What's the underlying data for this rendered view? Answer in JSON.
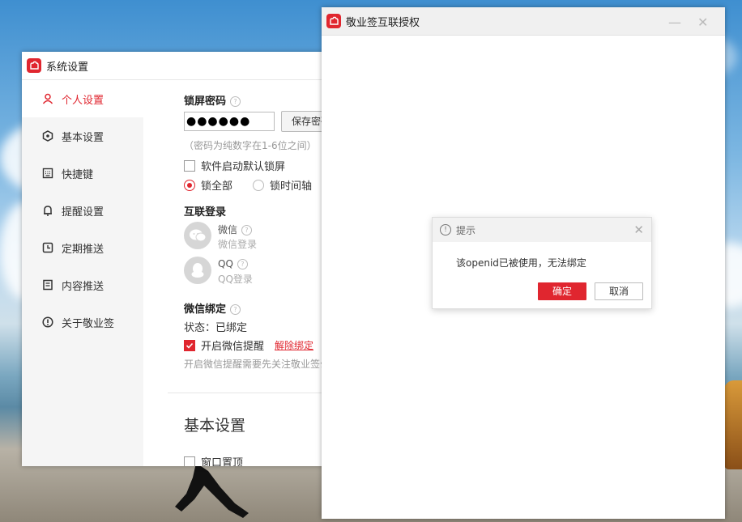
{
  "settings_window": {
    "title": "系统设置",
    "sidebar": {
      "items": [
        {
          "label": "个人设置",
          "icon": "user-icon",
          "active": true
        },
        {
          "label": "基本设置",
          "icon": "settings-icon",
          "active": false
        },
        {
          "label": "快捷键",
          "icon": "keyboard-icon",
          "active": false
        },
        {
          "label": "提醒设置",
          "icon": "bell-icon",
          "active": false
        },
        {
          "label": "定期推送",
          "icon": "clock-icon",
          "active": false
        },
        {
          "label": "内容推送",
          "icon": "document-icon",
          "active": false
        },
        {
          "label": "关于敬业签",
          "icon": "info-icon",
          "active": false
        }
      ]
    },
    "lock_password": {
      "title": "锁屏密码",
      "value": "●●●●●●",
      "save_label": "保存密码",
      "hint": "（密码为纯数字在1-6位之间）",
      "auto_lock_label": "软件启动默认锁屏",
      "auto_lock_checked": false,
      "radio_all": "锁全部",
      "radio_timeline": "锁时间轴"
    },
    "interconnect_login": {
      "title": "互联登录",
      "wechat_name": "微信",
      "wechat_sub": "微信登录",
      "qq_name": "QQ",
      "qq_sub": "QQ登录"
    },
    "wechat_binding": {
      "title": "微信绑定",
      "status": "状态：已绑定",
      "reminder_label": "开启微信提醒",
      "reminder_checked": true,
      "unbind_label": "解除绑定",
      "note": "开启微信提醒需要先关注敬业签公众号"
    },
    "basic_settings": {
      "title": "基本设置",
      "pin_window_label": "窗口置顶"
    }
  },
  "auth_window": {
    "title": "敬业签互联授权",
    "minimize": "—",
    "close": "✕"
  },
  "dialog": {
    "title": "提示",
    "message": "该openid已被使用，无法绑定",
    "ok_label": "确定",
    "cancel_label": "取消"
  },
  "colors": {
    "accent": "#e0262f"
  }
}
